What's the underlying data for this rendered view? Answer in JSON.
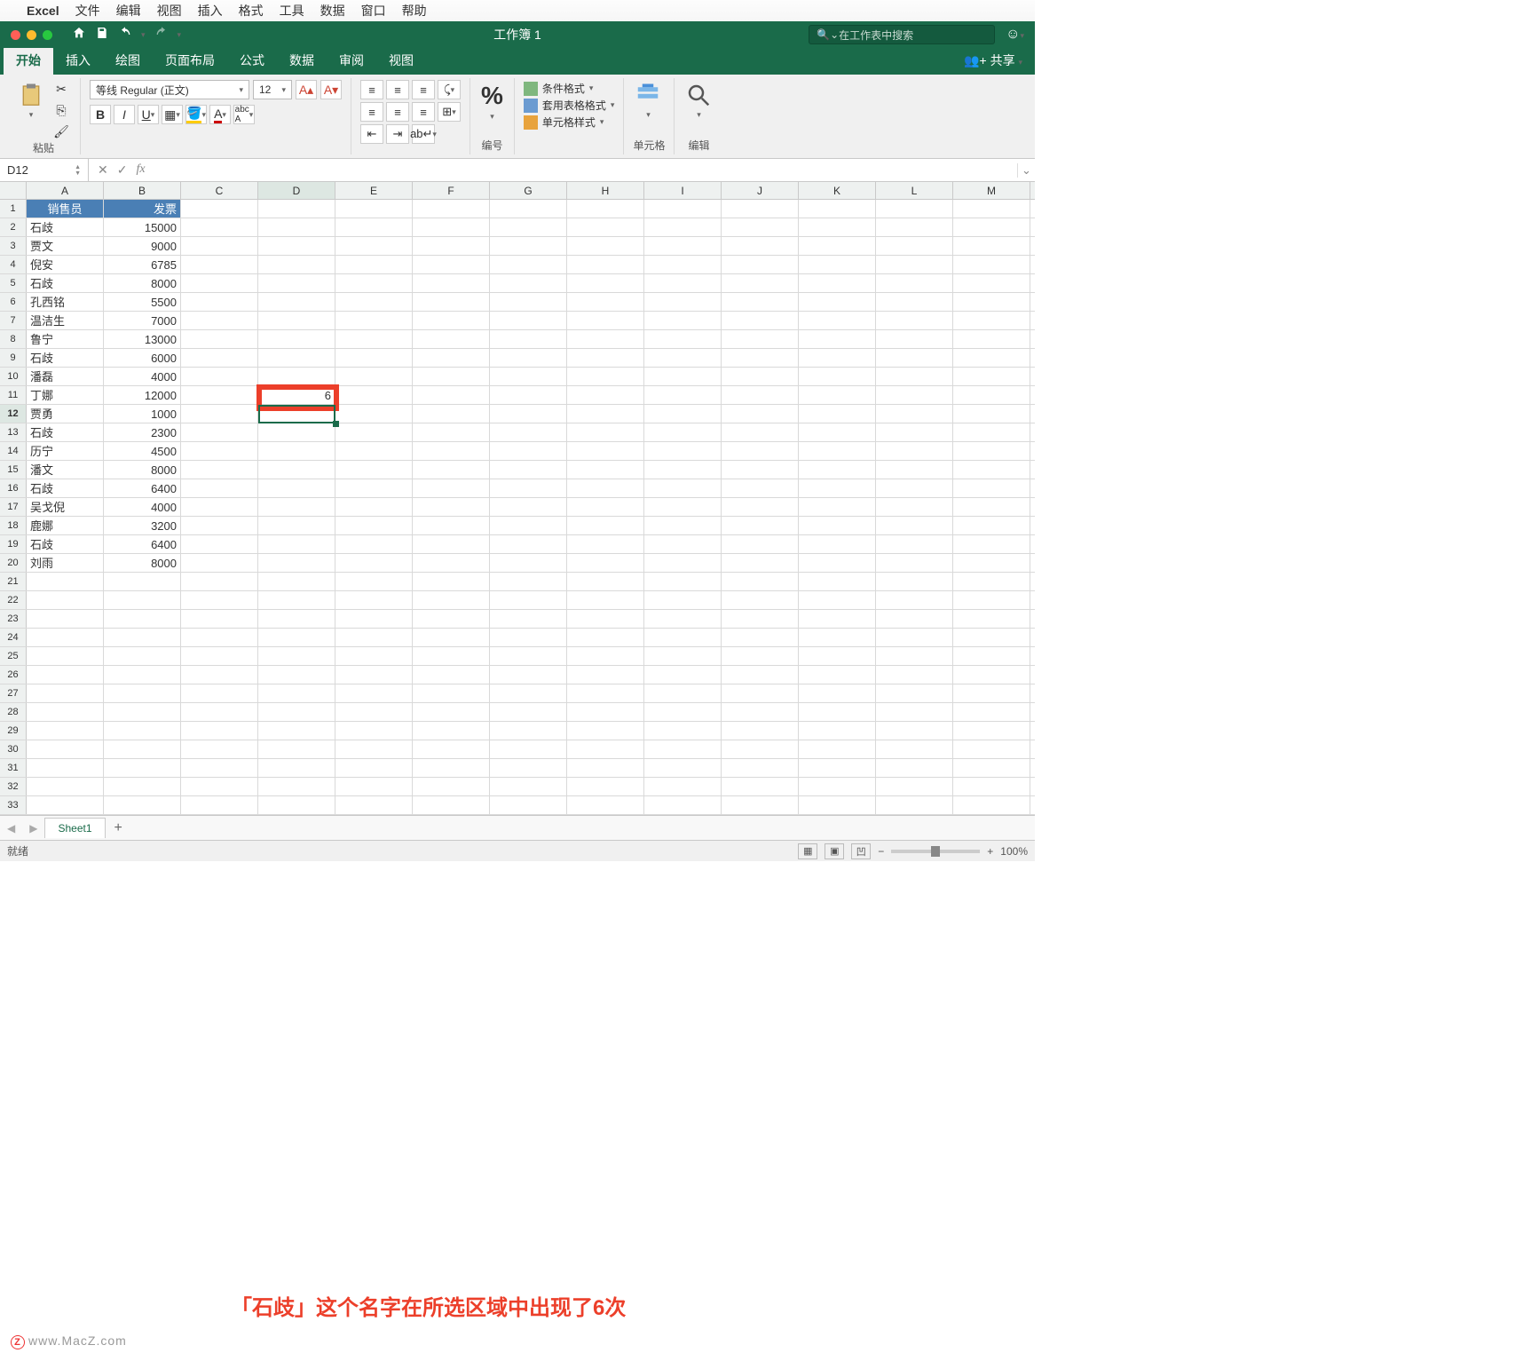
{
  "mac_menu": {
    "app": "Excel",
    "items": [
      "文件",
      "编辑",
      "视图",
      "插入",
      "格式",
      "工具",
      "数据",
      "窗口",
      "帮助"
    ]
  },
  "titlebar": {
    "workbook_title": "工作簿 1",
    "search_placeholder": "在工作表中搜索"
  },
  "ribbon_tabs": {
    "items": [
      "开始",
      "插入",
      "绘图",
      "页面布局",
      "公式",
      "数据",
      "审阅",
      "视图"
    ],
    "active": "开始",
    "share": "共享"
  },
  "ribbon": {
    "paste_label": "粘贴",
    "font_name": "等线 Regular (正文)",
    "font_size": "12",
    "number_label": "编号",
    "cond_fmt": "条件格式",
    "table_fmt": "套用表格格式",
    "cell_style": "单元格样式",
    "cells_label": "单元格",
    "edit_label": "编辑"
  },
  "formula_bar": {
    "name_box": "D12",
    "formula": ""
  },
  "columns": [
    "A",
    "B",
    "C",
    "D",
    "E",
    "F",
    "G",
    "H",
    "I",
    "J",
    "K",
    "L",
    "M"
  ],
  "row_count": 33,
  "headers": {
    "a": "销售员",
    "b": "发票"
  },
  "sales": [
    {
      "name": "石歧",
      "val": "15000"
    },
    {
      "name": "贾文",
      "val": "9000"
    },
    {
      "name": "倪安",
      "val": "6785"
    },
    {
      "name": "石歧",
      "val": "8000"
    },
    {
      "name": "孔西铭",
      "val": "5500"
    },
    {
      "name": "温洁生",
      "val": "7000"
    },
    {
      "name": "鲁宁",
      "val": "13000"
    },
    {
      "name": "石歧",
      "val": "6000"
    },
    {
      "name": "潘磊",
      "val": "4000"
    },
    {
      "name": "丁娜",
      "val": "12000"
    },
    {
      "name": "贾勇",
      "val": "1000"
    },
    {
      "name": "石歧",
      "val": "2300"
    },
    {
      "name": "历宁",
      "val": "4500"
    },
    {
      "name": "潘文",
      "val": "8000"
    },
    {
      "name": "石歧",
      "val": "6400"
    },
    {
      "name": "吴戈倪",
      "val": "4000"
    },
    {
      "name": "鹿娜",
      "val": "3200"
    },
    {
      "name": "石歧",
      "val": "6400"
    },
    {
      "name": "刘雨",
      "val": "8000"
    }
  ],
  "d11_value": "6",
  "sheet_tabs": {
    "active": "Sheet1"
  },
  "statusbar": {
    "status": "就绪",
    "zoom": "100%"
  },
  "annotation": "「石歧」这个名字在所选区域中出现了6次",
  "watermark": "www.MacZ.com"
}
